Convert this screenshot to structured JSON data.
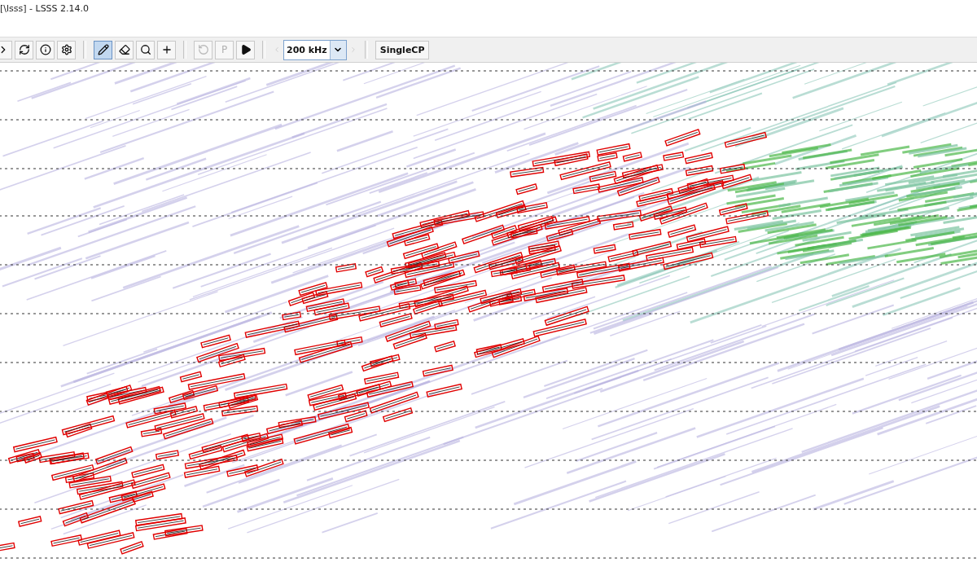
{
  "window": {
    "title": "[\\lsss] - LSSS 2.14.0"
  },
  "toolbar": {
    "items": [
      {
        "kind": "icon",
        "disabled": false
      },
      {
        "kind": "icon",
        "disabled": false
      },
      {
        "kind": "icon",
        "disabled": false
      },
      {
        "kind": "icon",
        "disabled": false
      },
      {
        "kind": "separator"
      },
      {
        "kind": "tool",
        "selected": true
      },
      {
        "kind": "tool",
        "selected": false
      },
      {
        "kind": "tool",
        "selected": false
      },
      {
        "kind": "tool",
        "selected": false
      },
      {
        "kind": "separator"
      },
      {
        "kind": "icon",
        "disabled": true
      },
      {
        "kind": "text",
        "label": "P",
        "disabled": true
      },
      {
        "kind": "icon",
        "disabled": false
      },
      {
        "kind": "separator"
      },
      {
        "kind": "icon",
        "disabled": true
      },
      {
        "kind": "dropdown",
        "value": "200 kHz"
      },
      {
        "kind": "icon",
        "disabled": true
      },
      {
        "kind": "separator"
      },
      {
        "kind": "button",
        "label": "SingleCP"
      }
    ]
  }
}
